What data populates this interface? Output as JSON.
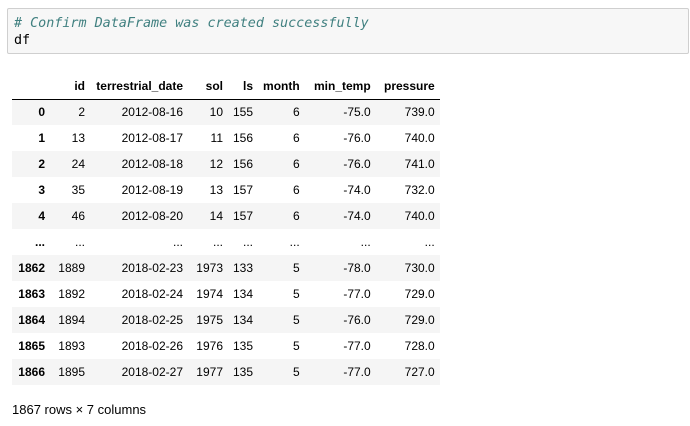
{
  "code_cell": {
    "comment": "# Confirm DataFrame was created successfully",
    "code": "df"
  },
  "dataframe": {
    "index_header": "",
    "columns": [
      "id",
      "terrestrial_date",
      "sol",
      "ls",
      "month",
      "min_temp",
      "pressure"
    ],
    "rows": [
      {
        "index": "0",
        "cells": [
          "2",
          "2012-08-16",
          "10",
          "155",
          "6",
          "-75.0",
          "739.0"
        ]
      },
      {
        "index": "1",
        "cells": [
          "13",
          "2012-08-17",
          "11",
          "156",
          "6",
          "-76.0",
          "740.0"
        ]
      },
      {
        "index": "2",
        "cells": [
          "24",
          "2012-08-18",
          "12",
          "156",
          "6",
          "-76.0",
          "741.0"
        ]
      },
      {
        "index": "3",
        "cells": [
          "35",
          "2012-08-19",
          "13",
          "157",
          "6",
          "-74.0",
          "732.0"
        ]
      },
      {
        "index": "4",
        "cells": [
          "46",
          "2012-08-20",
          "14",
          "157",
          "6",
          "-74.0",
          "740.0"
        ]
      },
      {
        "index": "...",
        "cells": [
          "...",
          "...",
          "...",
          "...",
          "...",
          "...",
          "..."
        ]
      },
      {
        "index": "1862",
        "cells": [
          "1889",
          "2018-02-23",
          "1973",
          "133",
          "5",
          "-78.0",
          "730.0"
        ]
      },
      {
        "index": "1863",
        "cells": [
          "1892",
          "2018-02-24",
          "1974",
          "134",
          "5",
          "-77.0",
          "729.0"
        ]
      },
      {
        "index": "1864",
        "cells": [
          "1894",
          "2018-02-25",
          "1975",
          "134",
          "5",
          "-76.0",
          "729.0"
        ]
      },
      {
        "index": "1865",
        "cells": [
          "1893",
          "2018-02-26",
          "1976",
          "135",
          "5",
          "-77.0",
          "728.0"
        ]
      },
      {
        "index": "1866",
        "cells": [
          "1895",
          "2018-02-27",
          "1977",
          "135",
          "5",
          "-77.0",
          "727.0"
        ]
      }
    ]
  },
  "shape_text": "1867 rows × 7 columns"
}
